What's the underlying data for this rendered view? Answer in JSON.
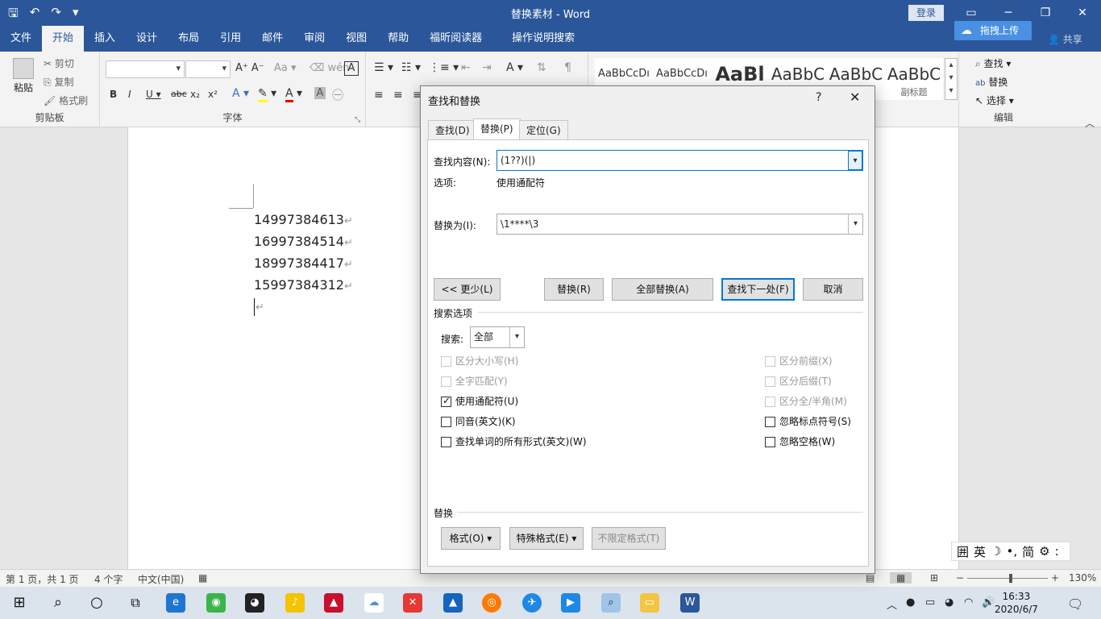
{
  "window": {
    "title": "替换素材 - Word",
    "login": "登录",
    "upload": "拖拽上传",
    "share": "共享"
  },
  "menu": {
    "tabs": [
      "文件",
      "开始",
      "插入",
      "设计",
      "布局",
      "引用",
      "邮件",
      "审阅",
      "视图",
      "帮助",
      "福昕阅读器",
      "操作说明搜索"
    ],
    "active": "开始"
  },
  "ribbon": {
    "clipboard": {
      "label": "剪贴板",
      "paste": "粘贴",
      "cut": "剪切",
      "copy": "复制",
      "format_painter": "格式刷"
    },
    "font": {
      "label": "字体"
    },
    "styles": [
      {
        "preview": "AaBbCcDı"
      },
      {
        "preview": "AaBbCcDı"
      },
      {
        "preview": "AaBl"
      },
      {
        "preview": "AaBbC"
      },
      {
        "preview": "AaBbC"
      },
      {
        "preview": "AaBbC",
        "name": "副标题"
      }
    ],
    "editing": {
      "label": "编辑",
      "find": "查找",
      "replace": "替换",
      "select": "选择"
    }
  },
  "document": {
    "lines": [
      "14997384613",
      "16997384514",
      "18997384417",
      "15997384312"
    ],
    "para_mark": "↵"
  },
  "dialog": {
    "title": "查找和替换",
    "help": "?",
    "close": "✕",
    "tabs": [
      "查找(D)",
      "替换(P)",
      "定位(G)"
    ],
    "find_label": "查找内容(N):",
    "find_value": "(1??)(|)",
    "options_label": "选项:",
    "options_value": "使用通配符",
    "replace_label": "替换为(I):",
    "replace_value": "\\1****\\3",
    "buttons": {
      "less": "<< 更少(L)",
      "replace": "替换(R)",
      "replace_all": "全部替换(A)",
      "find_next": "查找下一处(F)",
      "cancel": "取消"
    },
    "search_options_title": "搜索选项",
    "search_label": "搜索:",
    "search_value": "全部",
    "checks_left": [
      {
        "label": "区分大小写(H)",
        "checked": false,
        "disabled": true
      },
      {
        "label": "全字匹配(Y)",
        "checked": false,
        "disabled": true
      },
      {
        "label": "使用通配符(U)",
        "checked": true,
        "disabled": false
      },
      {
        "label": "同音(英文)(K)",
        "checked": false,
        "disabled": false
      },
      {
        "label": "查找单词的所有形式(英文)(W)",
        "checked": false,
        "disabled": false
      }
    ],
    "checks_right": [
      {
        "label": "区分前缀(X)",
        "checked": false,
        "disabled": true
      },
      {
        "label": "区分后缀(T)",
        "checked": false,
        "disabled": true
      },
      {
        "label": "区分全/半角(M)",
        "checked": false,
        "disabled": true
      },
      {
        "label": "忽略标点符号(S)",
        "checked": false,
        "disabled": false
      },
      {
        "label": "忽略空格(W)",
        "checked": false,
        "disabled": false
      }
    ],
    "replace_section_title": "替换",
    "format_button": "格式(O) ▾",
    "special_button": "特殊格式(E) ▾",
    "no_format_button": "不限定格式(T)"
  },
  "status": {
    "page": "第 1 页，共 1 页",
    "words": "4 个字",
    "language": "中文(中国)",
    "zoom": "130%"
  },
  "ime": {
    "items": [
      "囲",
      "英",
      "☽",
      "•,",
      "简",
      "⚙",
      ":"
    ]
  },
  "taskbar": {
    "time": "16:33",
    "date": "2020/6/7"
  }
}
